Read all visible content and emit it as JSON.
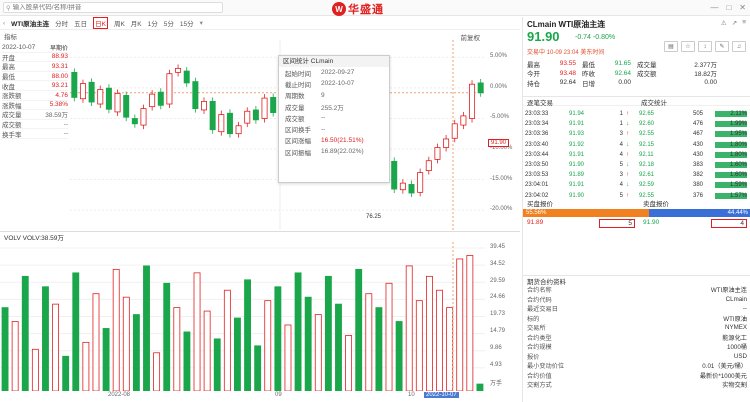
{
  "top": {
    "search_placeholder": "输入股票代码/名称/拼音",
    "brand": "华盛通",
    "brand_mark": "W"
  },
  "toolbar": {
    "title": "WTI原油主连",
    "tabs": [
      "分时",
      "五日",
      "日K",
      "周K",
      "月K",
      "1分",
      "5分",
      "15分"
    ],
    "active": "日K"
  },
  "chart_header": {
    "left": "指标",
    "right": "前复权"
  },
  "info": {
    "date": "2022-10-07",
    "mode": "早期价",
    "rows": [
      {
        "label": "开盘",
        "value": "88.93",
        "color": "red"
      },
      {
        "label": "最高",
        "value": "93.31",
        "color": "red"
      },
      {
        "label": "最低",
        "value": "88.00",
        "color": "red"
      },
      {
        "label": "收盘",
        "value": "93.21",
        "color": "red"
      },
      {
        "label": "涨跌额",
        "value": "4.76",
        "color": "red"
      },
      {
        "label": "涨跌幅",
        "value": "5.38%",
        "color": "red"
      },
      {
        "label": "成交量",
        "value": "38.59万",
        "color": "grey"
      },
      {
        "label": "成交额",
        "value": "--",
        "color": "grey"
      },
      {
        "label": "换手率",
        "value": "--",
        "color": "grey"
      }
    ]
  },
  "popup": {
    "title": "区间统计 CLmain",
    "rows": [
      {
        "label": "起始时间",
        "value": "2022-09-27",
        "color": "grey"
      },
      {
        "label": "截止时间",
        "value": "2022-10-07",
        "color": "grey"
      },
      {
        "label": "周期数",
        "value": "9",
        "color": "grey"
      },
      {
        "label": "成交量",
        "value": "255.2万",
        "color": "grey"
      },
      {
        "label": "成交额",
        "value": "--",
        "color": "grey"
      },
      {
        "label": "区间换手",
        "value": "--",
        "color": "grey"
      },
      {
        "label": "区间涨幅",
        "value": "16.50(21.51%)",
        "color": "red"
      },
      {
        "label": "区间振幅",
        "value": "16.89(22.02%)",
        "color": "grey"
      }
    ]
  },
  "price_axis": [
    "5.00%",
    "0.00%",
    "-5.00%",
    "-10.00%",
    "-15.00%",
    "-20.00%"
  ],
  "price_tag": "91.90",
  "low_label": "76.25",
  "vol_header": "VOLV  VOLV:38.59万",
  "vol_axis": [
    "39.45",
    "34.52",
    "29.59",
    "24.66",
    "19.73",
    "14.79",
    "9.86",
    "4.93",
    "万手"
  ],
  "xaxis": {
    "a": "2022-08",
    "b": "09",
    "c": "10",
    "tag": "2022-10-07"
  },
  "right": {
    "symbol": "CLmain  WTI原油主连",
    "price": "91.90",
    "change": "-0.74  -0.80%",
    "time": "交易中 10-09 23:04 美东时间",
    "quote": [
      [
        "最高",
        "93.55",
        "最低",
        "91.65",
        "成交量",
        "2.377万"
      ],
      [
        "今开",
        "93.48",
        "昨收",
        "92.64",
        "成交额",
        "18.82万"
      ],
      [
        "持仓",
        "92.64",
        "日增",
        "0.00",
        "",
        "0.00"
      ]
    ],
    "trades_title": "逐笔交易",
    "stats_title": "成交统计",
    "trades": [
      [
        "23:03:33",
        "91.94",
        "1"
      ],
      [
        "23:03:34",
        "91.91",
        "1"
      ],
      [
        "23:03:36",
        "91.93",
        "3"
      ],
      [
        "23:03:40",
        "91.92",
        "4"
      ],
      [
        "23:03:44",
        "91.91",
        "4"
      ],
      [
        "23:03:50",
        "91.90",
        "5"
      ],
      [
        "23:03:53",
        "91.89",
        "3"
      ],
      [
        "23:04:01",
        "91.91",
        "4"
      ],
      [
        "23:04:02",
        "91.90",
        "5"
      ]
    ],
    "stats": [
      [
        "92.65",
        "505",
        "2.11%"
      ],
      [
        "92.60",
        "476",
        "1.99%"
      ],
      [
        "92.55",
        "467",
        "1.95%"
      ],
      [
        "92.15",
        "430",
        "1.80%"
      ],
      [
        "92.11",
        "430",
        "1.80%"
      ],
      [
        "92.18",
        "383",
        "1.60%"
      ],
      [
        "92.61",
        "382",
        "1.60%"
      ],
      [
        "92.59",
        "380",
        "1.59%"
      ],
      [
        "92.55",
        "376",
        "1.57%"
      ]
    ],
    "bid_title": "买盘报价",
    "ask_title": "卖盘报价",
    "bid_pct": "55.56%",
    "ask_pct": "44.44%",
    "bid_price": "91.89",
    "bid_size": "5",
    "ask_price": "91.90",
    "ask_size": "4",
    "fut_title": "期货合约资料",
    "fut": [
      [
        "合约名称",
        "WTI原油主连"
      ],
      [
        "合约代码",
        "CLmain"
      ],
      [
        "最近交易日",
        "--"
      ],
      [
        "标的",
        "WTI原油"
      ],
      [
        "交易所",
        "NYMEX"
      ],
      [
        "合约类型",
        "能源化工"
      ],
      [
        "合约规模",
        "1000桶"
      ],
      [
        "报价",
        "USD"
      ],
      [
        "最小变动价位",
        "0.01（美元/桶）"
      ],
      [
        "合约价值",
        "最新价*1000美元"
      ],
      [
        "交割方式",
        "实物交割"
      ]
    ]
  },
  "chart_data": {
    "type": "candlestick",
    "candles": [
      {
        "o": 95.0,
        "c": 91.2
      },
      {
        "o": 91.0,
        "c": 93.3
      },
      {
        "o": 93.5,
        "c": 90.5
      },
      {
        "o": 90.2,
        "c": 92.4
      },
      {
        "o": 92.6,
        "c": 89.4
      },
      {
        "o": 89.0,
        "c": 91.8
      },
      {
        "o": 91.5,
        "c": 88.2
      },
      {
        "o": 88.0,
        "c": 87.2
      },
      {
        "o": 87.0,
        "c": 89.5
      },
      {
        "o": 89.8,
        "c": 91.7
      },
      {
        "o": 92.0,
        "c": 90.0
      },
      {
        "o": 90.2,
        "c": 94.8
      },
      {
        "o": 95.0,
        "c": 95.6
      },
      {
        "o": 95.2,
        "c": 93.4
      },
      {
        "o": 93.6,
        "c": 89.5
      },
      {
        "o": 89.3,
        "c": 90.6
      },
      {
        "o": 90.6,
        "c": 86.3
      },
      {
        "o": 86.0,
        "c": 88.6
      },
      {
        "o": 88.8,
        "c": 85.7
      },
      {
        "o": 85.7,
        "c": 86.9
      },
      {
        "o": 87.3,
        "c": 89.1
      },
      {
        "o": 89.3,
        "c": 87.8
      },
      {
        "o": 88.0,
        "c": 91.1
      },
      {
        "o": 91.2,
        "c": 88.9
      },
      {
        "o": 88.6,
        "c": 88.1
      },
      {
        "o": 88.1,
        "c": 86.7
      },
      {
        "o": 86.4,
        "c": 88.0
      },
      {
        "o": 88.0,
        "c": 87.0
      },
      {
        "o": 87.2,
        "c": 90.0
      },
      {
        "o": 90.0,
        "c": 86.4
      },
      {
        "o": 86.3,
        "c": 84.1
      },
      {
        "o": 84.0,
        "c": 86.7
      },
      {
        "o": 86.8,
        "c": 84.6
      },
      {
        "o": 84.5,
        "c": 82.4
      },
      {
        "o": 82.4,
        "c": 83.1
      },
      {
        "o": 83.3,
        "c": 79.3
      },
      {
        "o": 79.6,
        "c": 81.4
      },
      {
        "o": 81.5,
        "c": 77.3
      },
      {
        "o": 77.2,
        "c": 78.2
      },
      {
        "o": 78.0,
        "c": 76.7
      },
      {
        "o": 76.8,
        "c": 79.8
      },
      {
        "o": 80.1,
        "c": 81.6
      },
      {
        "o": 81.8,
        "c": 83.6
      },
      {
        "o": 83.6,
        "c": 84.9
      },
      {
        "o": 85.0,
        "c": 87.2
      },
      {
        "o": 87.0,
        "c": 88.4
      },
      {
        "o": 88.0,
        "c": 93.2
      },
      {
        "o": 93.4,
        "c": 91.9
      }
    ],
    "volumes": [
      24,
      20,
      33,
      12,
      30,
      25,
      10,
      34,
      14,
      28,
      18,
      35,
      27,
      22,
      36,
      11,
      31,
      24,
      17,
      34,
      23,
      15,
      29,
      21,
      32,
      13,
      26,
      30,
      19,
      34,
      27,
      22,
      33,
      25,
      16,
      35,
      28,
      24,
      31,
      20,
      36,
      26,
      33,
      29,
      24,
      38,
      39,
      2
    ],
    "low_index": 39,
    "low_value": 76.25,
    "price_scale": {
      "ref": 92.64
    },
    "pct_axis": [
      5,
      0,
      -5,
      -10,
      -15,
      -20
    ]
  }
}
